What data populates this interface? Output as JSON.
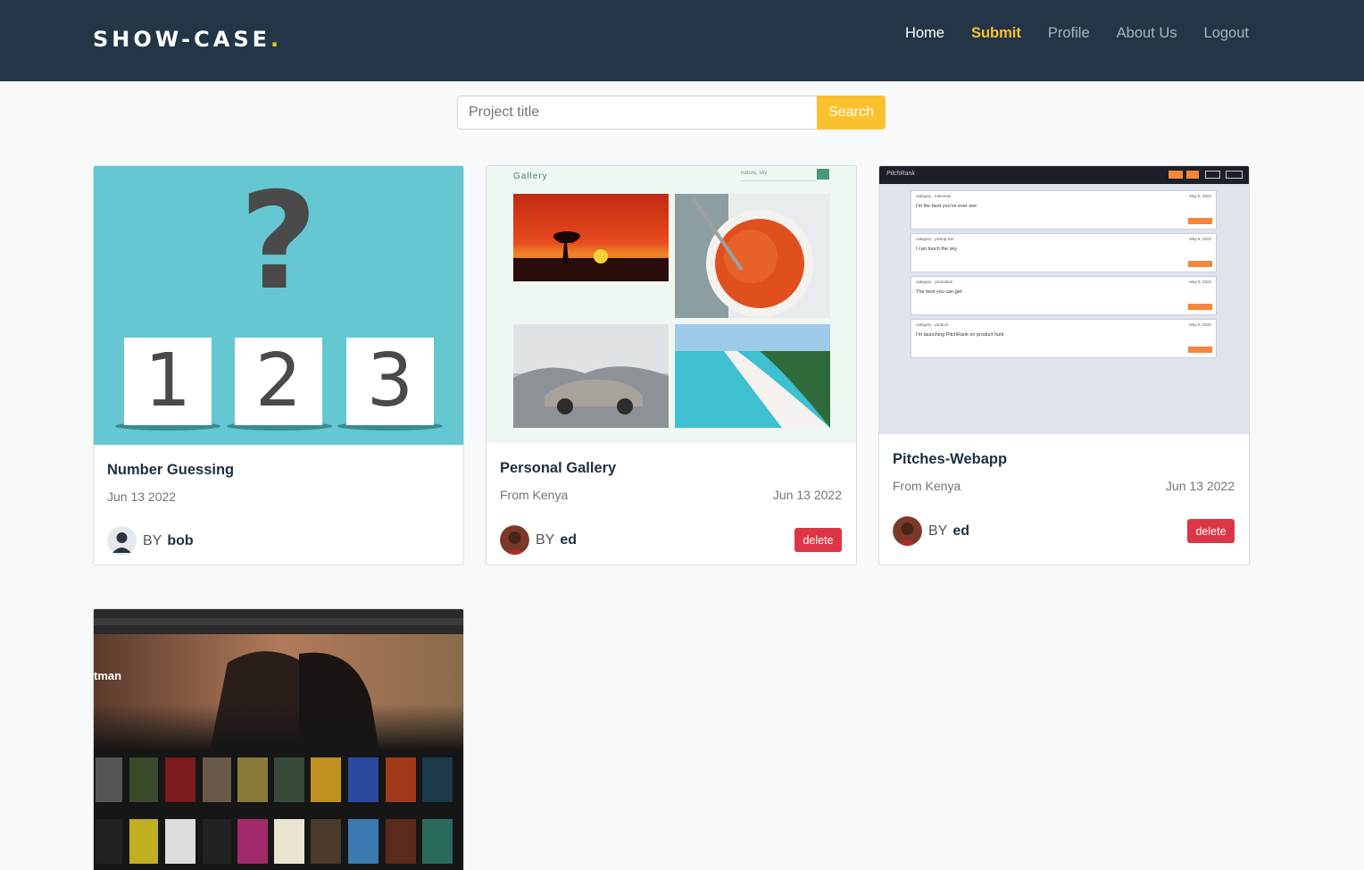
{
  "brand": {
    "name": "SHOW-CASE",
    "dot": "."
  },
  "nav": {
    "home": "Home",
    "submit": "Submit",
    "profile": "Profile",
    "about": "About Us",
    "logout": "Logout"
  },
  "search": {
    "placeholder": "Project title",
    "button": "Search"
  },
  "cards": [
    {
      "title": "Number Guessing",
      "location": "",
      "date": "Jun 13 2022",
      "by": "BY",
      "author": "bob",
      "delete": "",
      "thumb": {
        "digits": [
          "?",
          "1",
          "2",
          "3"
        ]
      }
    },
    {
      "title": "Personal Gallery",
      "location": "From Kenya",
      "date": "Jun 13 2022",
      "by": "BY",
      "author": "ed",
      "delete": "delete",
      "thumb": {
        "label": "Gallery",
        "search": "nature, sky"
      }
    },
    {
      "title": "Pitches-Webapp",
      "location": "From Kenya",
      "date": "Jun 13 2022",
      "by": "BY",
      "author": "ed",
      "delete": "delete",
      "thumb": {
        "app": "PitchRank",
        "posts": [
          {
            "category": "category - interview",
            "date": "May 8, 2022",
            "text": "I'm the best you've ever see"
          },
          {
            "category": "category - pickup line",
            "date": "May 8, 2022",
            "text": "I can touch the sky"
          },
          {
            "category": "category - promotion",
            "date": "May 8, 2022",
            "text": "The best you can get"
          },
          {
            "category": "category - product",
            "date": "May 8, 2022",
            "text": "I'm launching PitchRank on product hunt"
          }
        ]
      }
    },
    {
      "title": "",
      "location": "",
      "date": "",
      "by": "",
      "author": "",
      "delete": "",
      "thumb": {
        "heading": "tman"
      }
    }
  ],
  "colors": {
    "navbar": "#233546",
    "accent": "#fbc02d",
    "danger": "#dc3545",
    "title": "#1d2f41"
  }
}
